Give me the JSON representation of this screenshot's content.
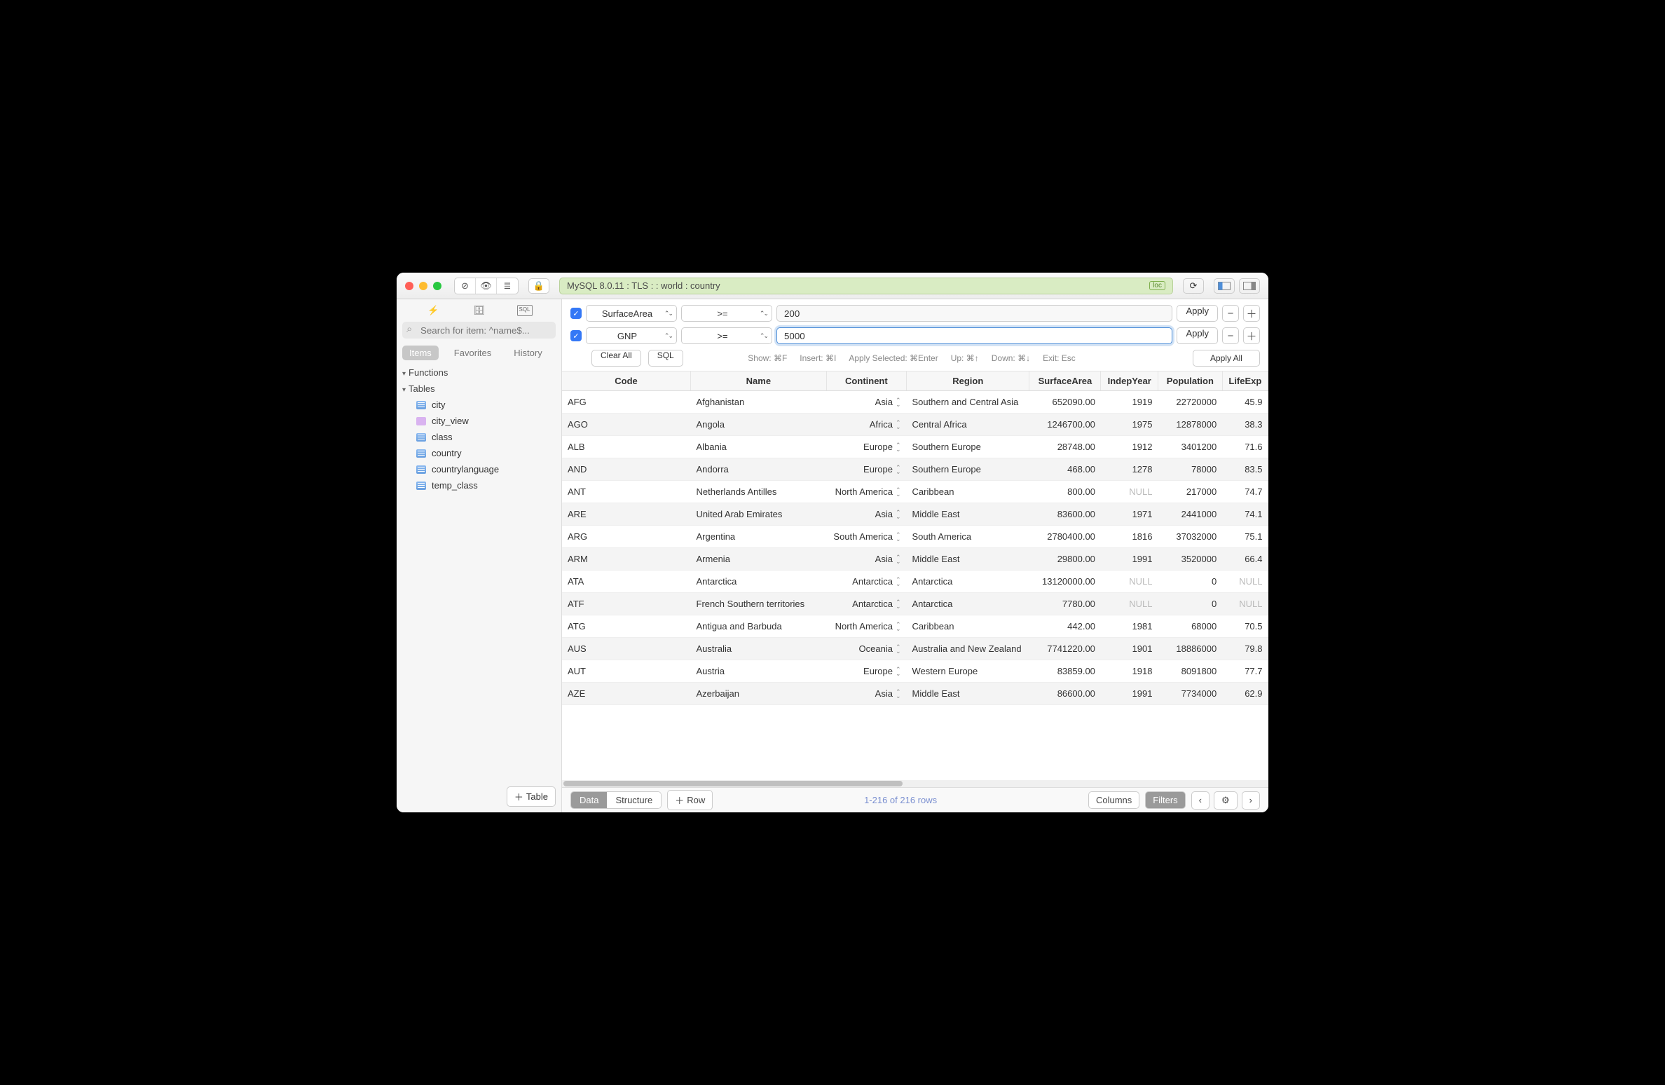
{
  "connection": "MySQL 8.0.11 : TLS :  : world : country",
  "loc_badge": "loc",
  "search_placeholder": "Search for item: ^name$...",
  "sidebar_tabs": {
    "items": "Items",
    "favorites": "Favorites",
    "history": "History"
  },
  "sections": {
    "functions": "Functions",
    "tables": "Tables"
  },
  "tables": [
    "city",
    "city_view",
    "class",
    "country",
    "countrylanguage",
    "temp_class"
  ],
  "add_table": "Table",
  "filters": [
    {
      "field": "SurfaceArea",
      "op": ">=",
      "value": "200",
      "focused": false
    },
    {
      "field": "GNP",
      "op": ">=",
      "value": "5000",
      "focused": true
    }
  ],
  "filter_buttons": {
    "apply": "Apply",
    "clear_all": "Clear All",
    "sql": "SQL",
    "apply_all": "Apply All"
  },
  "hints": {
    "show": "Show: ⌘F",
    "insert": "Insert: ⌘I",
    "apply_sel": "Apply Selected: ⌘Enter",
    "up": "Up: ⌘↑",
    "down": "Down: ⌘↓",
    "exit": "Exit: Esc"
  },
  "columns": [
    "Code",
    "Name",
    "Continent",
    "Region",
    "SurfaceArea",
    "IndepYear",
    "Population",
    "LifeExp"
  ],
  "rows": [
    {
      "Code": "AFG",
      "Name": "Afghanistan",
      "Continent": "Asia",
      "Region": "Southern and Central Asia",
      "SurfaceArea": "652090.00",
      "IndepYear": "1919",
      "Population": "22720000",
      "LifeExp": "45.9"
    },
    {
      "Code": "AGO",
      "Name": "Angola",
      "Continent": "Africa",
      "Region": "Central Africa",
      "SurfaceArea": "1246700.00",
      "IndepYear": "1975",
      "Population": "12878000",
      "LifeExp": "38.3"
    },
    {
      "Code": "ALB",
      "Name": "Albania",
      "Continent": "Europe",
      "Region": "Southern Europe",
      "SurfaceArea": "28748.00",
      "IndepYear": "1912",
      "Population": "3401200",
      "LifeExp": "71.6"
    },
    {
      "Code": "AND",
      "Name": "Andorra",
      "Continent": "Europe",
      "Region": "Southern Europe",
      "SurfaceArea": "468.00",
      "IndepYear": "1278",
      "Population": "78000",
      "LifeExp": "83.5"
    },
    {
      "Code": "ANT",
      "Name": "Netherlands Antilles",
      "Continent": "North America",
      "Region": "Caribbean",
      "SurfaceArea": "800.00",
      "IndepYear": "NULL",
      "Population": "217000",
      "LifeExp": "74.7"
    },
    {
      "Code": "ARE",
      "Name": "United Arab Emirates",
      "Continent": "Asia",
      "Region": "Middle East",
      "SurfaceArea": "83600.00",
      "IndepYear": "1971",
      "Population": "2441000",
      "LifeExp": "74.1"
    },
    {
      "Code": "ARG",
      "Name": "Argentina",
      "Continent": "South America",
      "Region": "South America",
      "SurfaceArea": "2780400.00",
      "IndepYear": "1816",
      "Population": "37032000",
      "LifeExp": "75.1"
    },
    {
      "Code": "ARM",
      "Name": "Armenia",
      "Continent": "Asia",
      "Region": "Middle East",
      "SurfaceArea": "29800.00",
      "IndepYear": "1991",
      "Population": "3520000",
      "LifeExp": "66.4"
    },
    {
      "Code": "ATA",
      "Name": "Antarctica",
      "Continent": "Antarctica",
      "Region": "Antarctica",
      "SurfaceArea": "13120000.00",
      "IndepYear": "NULL",
      "Population": "0",
      "LifeExp": "NULL"
    },
    {
      "Code": "ATF",
      "Name": "French Southern territories",
      "Continent": "Antarctica",
      "Region": "Antarctica",
      "SurfaceArea": "7780.00",
      "IndepYear": "NULL",
      "Population": "0",
      "LifeExp": "NULL"
    },
    {
      "Code": "ATG",
      "Name": "Antigua and Barbuda",
      "Continent": "North America",
      "Region": "Caribbean",
      "SurfaceArea": "442.00",
      "IndepYear": "1981",
      "Population": "68000",
      "LifeExp": "70.5"
    },
    {
      "Code": "AUS",
      "Name": "Australia",
      "Continent": "Oceania",
      "Region": "Australia and New Zealand",
      "SurfaceArea": "7741220.00",
      "IndepYear": "1901",
      "Population": "18886000",
      "LifeExp": "79.8"
    },
    {
      "Code": "AUT",
      "Name": "Austria",
      "Continent": "Europe",
      "Region": "Western Europe",
      "SurfaceArea": "83859.00",
      "IndepYear": "1918",
      "Population": "8091800",
      "LifeExp": "77.7"
    },
    {
      "Code": "AZE",
      "Name": "Azerbaijan",
      "Continent": "Asia",
      "Region": "Middle East",
      "SurfaceArea": "86600.00",
      "IndepYear": "1991",
      "Population": "7734000",
      "LifeExp": "62.9"
    }
  ],
  "footer": {
    "data": "Data",
    "structure": "Structure",
    "row": "Row",
    "status": "1-216 of 216 rows",
    "columns": "Columns",
    "filters": "Filters"
  }
}
